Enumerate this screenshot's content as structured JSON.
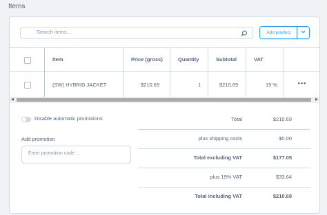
{
  "section": {
    "title": "Items"
  },
  "search": {
    "placeholder": "Search items..."
  },
  "toolbar": {
    "add_label": "Add product"
  },
  "table": {
    "columns": [
      "Item",
      "Price (gross)",
      "Quantity",
      "Subtotal",
      "VAT"
    ],
    "rows": [
      {
        "item": "(SW) HYBRID JACKET",
        "price": "$210.69",
        "quantity": "1",
        "subtotal": "$210.69",
        "vat": "19 %"
      }
    ],
    "row_actions": "•••"
  },
  "promotions": {
    "toggle_label": "Disable automatic promotions",
    "add_label": "Add promotion",
    "input_placeholder": "Enter promotion code ..."
  },
  "summary": [
    {
      "label": "Total",
      "value": "$210.69",
      "bold": false
    },
    {
      "label": "plus shipping costs",
      "value": "$0.00",
      "bold": false
    },
    {
      "label": "Total excluding VAT",
      "value": "$177.05",
      "bold": true
    },
    {
      "label": "plus 19% VAT",
      "value": "$33.64",
      "bold": false
    },
    {
      "label": "Total including VAT",
      "value": "$210.69",
      "bold": true
    }
  ],
  "colors": {
    "accent": "#189eff",
    "border": "#d1d9e0",
    "text": "#52667a"
  }
}
